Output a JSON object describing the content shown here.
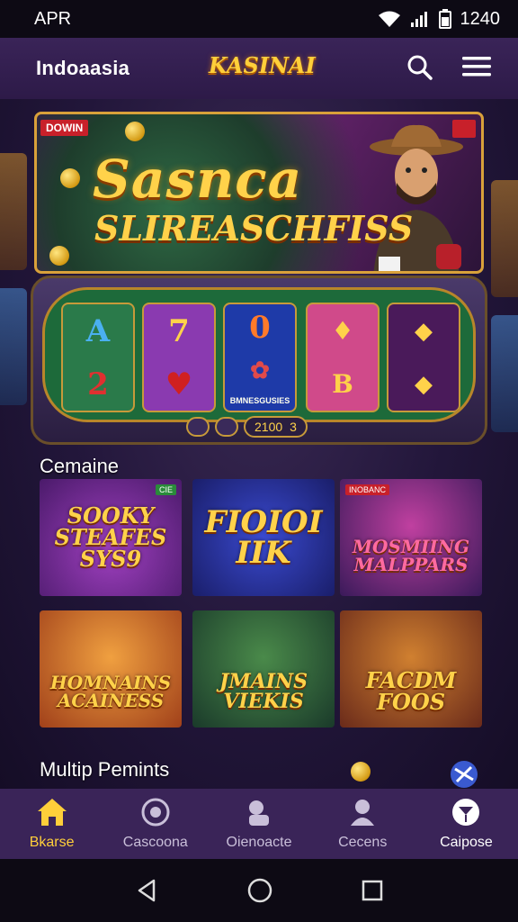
{
  "status_bar": {
    "carrier": "APR",
    "time": "1240"
  },
  "header": {
    "region": "Indoaasia",
    "logo": "KASINAI",
    "icons": [
      "search-icon",
      "menu-icon"
    ]
  },
  "banner": {
    "corner_left": "DOWIN",
    "title_line1": "Sasnca",
    "title_line2": "SLIREASCHFISS"
  },
  "slot": {
    "reel_label": "BMNESGUSIES",
    "bet_value": "2100",
    "bet_count": "3"
  },
  "section1": {
    "title": "Cemaine",
    "games": [
      {
        "title": "SOOKY STEAFES SYS9",
        "tag": "CIE"
      },
      {
        "title": "FIOIOI IIK",
        "tag": ""
      },
      {
        "title": "MOSMIING MALPPARS",
        "tag": "INOBANC"
      },
      {
        "title": "HOMNAINS ACAINESS",
        "tag": ""
      },
      {
        "title": "JMAINS VIEKIS",
        "tag": ""
      },
      {
        "title": "FACDM FOOS",
        "tag": ""
      }
    ]
  },
  "section2": {
    "title": "Multip Pemints"
  },
  "bottom_nav": {
    "items": [
      {
        "label": "Bkarse",
        "icon": "home-icon"
      },
      {
        "label": "Cascoona",
        "icon": "slots-icon"
      },
      {
        "label": "Oienoacte",
        "icon": "cards-icon"
      },
      {
        "label": "Cecens",
        "icon": "profile-icon"
      },
      {
        "label": "Caipose",
        "icon": "cocktail-icon"
      }
    ]
  },
  "colors": {
    "accent_gold": "#ffcf3a",
    "nav_bg": "#3a2458",
    "page_bg": "#1a0f2e"
  }
}
